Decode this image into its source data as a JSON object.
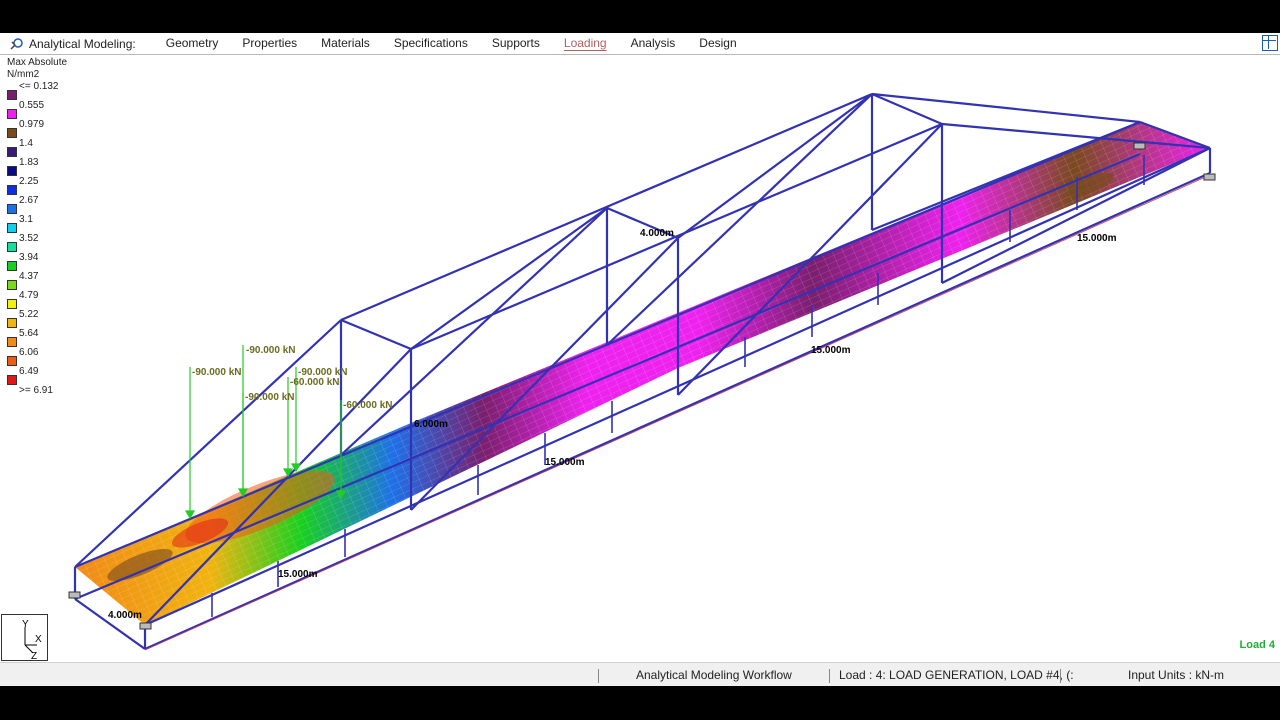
{
  "app": {
    "title": "Analytical Modeling:",
    "tabs": [
      "Geometry",
      "Properties",
      "Materials",
      "Specifications",
      "Supports",
      "Loading",
      "Analysis",
      "Design"
    ],
    "active_tab": "Loading"
  },
  "legend": {
    "title": "Max Absolute",
    "unit": "N/mm2",
    "items": [
      {
        "label": "<= 0.132",
        "color": "#7a1f6e"
      },
      {
        "label": "0.555",
        "color": "#ee22ee"
      },
      {
        "label": "0.979",
        "color": "#7a4a1f"
      },
      {
        "label": "1.4",
        "color": "#3b1a7a"
      },
      {
        "label": "1.83",
        "color": "#0a0a8a"
      },
      {
        "label": "2.25",
        "color": "#1030e0"
      },
      {
        "label": "2.67",
        "color": "#1e70e8"
      },
      {
        "label": "3.1",
        "color": "#10d0f0"
      },
      {
        "label": "3.52",
        "color": "#10e09a"
      },
      {
        "label": "3.94",
        "color": "#18d020"
      },
      {
        "label": "4.37",
        "color": "#7ad81a"
      },
      {
        "label": "4.79",
        "color": "#f2f010"
      },
      {
        "label": "5.22",
        "color": "#f0b410"
      },
      {
        "label": "5.64",
        "color": "#f08a18"
      },
      {
        "label": "6.06",
        "color": "#f05a18"
      },
      {
        "label": "6.49",
        "color": "#e01818"
      },
      {
        "label": ">= 6.91",
        "color": ""
      }
    ]
  },
  "model": {
    "dimensions": {
      "span_1": "15.000m",
      "span_2": "15.000m",
      "span_3": "15.000m",
      "span_4": "15.000m",
      "width_bottom": "4.000m",
      "width_top": "4.000m",
      "height": "6.000m"
    },
    "loads": {
      "l1": "-90.000 kN",
      "l2": "-90.000 kN",
      "l3": "-90.000 kN",
      "l4": "-60.000 kN",
      "l5": "-90.000 kN",
      "l6": "-60.000 kN"
    },
    "colors": {
      "member": "#3232b4",
      "load_arrow": "#22cc22",
      "load_text": "#6b6b20",
      "deck_hot": "#f08a18",
      "deck_magenta": "#ee22ee"
    }
  },
  "triad": {
    "y": "Y",
    "x": "X",
    "z": "Z"
  },
  "load_case_label": "Load 4",
  "status": {
    "workflow": "Analytical Modeling Workflow",
    "load": "Load : 4: LOAD GENERATION, LOAD #4, (:",
    "units": "Input Units : kN-m"
  }
}
